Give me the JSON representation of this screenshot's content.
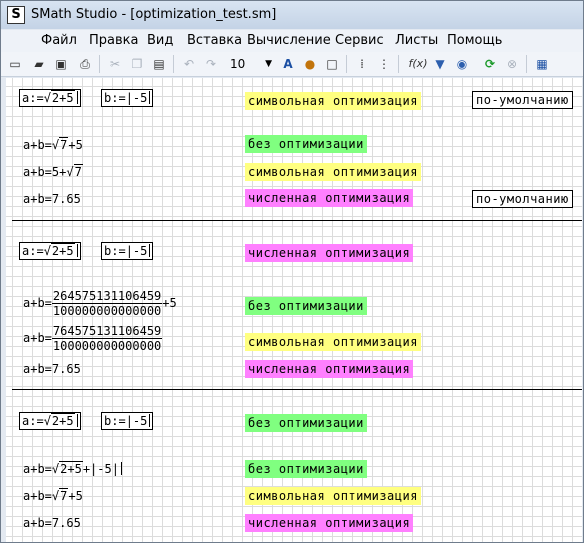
{
  "window": {
    "title": "SMath Studio - [optimization_test.sm]",
    "app_icon": "S"
  },
  "menu": [
    "Файл",
    "Правка",
    "Вид",
    "Вставка",
    "Вычисление",
    "Сервис",
    "Листы",
    "Помощь"
  ],
  "toolbar": {
    "font_size": "10",
    "fx": "f(x)"
  },
  "sections": [
    {
      "defs": {
        "a": "a:=√2+5",
        "b": "b:=-5"
      },
      "mode_label": "символьная оптимизация",
      "default_label": "по-умолчанию",
      "rows": [
        {
          "expr_prefix": "a+b=",
          "sqrt": "7",
          "expr_suffix": "+5",
          "label": "без оптимизации"
        },
        {
          "expr_prefix": "a+b=5+",
          "sqrt": "7",
          "expr_suffix": "",
          "label": "символьная оптимизация"
        },
        {
          "expr": "a+b=7.65",
          "label": "численная оптимизация",
          "default_label": "по-умолчанию"
        }
      ]
    },
    {
      "defs": {
        "a": "a:=√2+5",
        "b": "b:=-5"
      },
      "mode_label": "численная оптимизация",
      "rows": [
        {
          "expr_prefix": "a+b=",
          "num": "264575131106459",
          "den": "100000000000000",
          "expr_suffix": "+5",
          "label": "без оптимизации"
        },
        {
          "expr_prefix": "a+b=",
          "num": "764575131106459",
          "den": "100000000000000",
          "expr_suffix": "",
          "label": "символьная оптимизация"
        },
        {
          "expr": "a+b=7.65",
          "label": "численная оптимизация"
        }
      ]
    },
    {
      "defs": {
        "a": "a:=√2+5",
        "b": "b:=-5"
      },
      "mode_label": "без оптимизации",
      "rows": [
        {
          "expr_prefix": "a+b=",
          "sqrt": "2+5",
          "expr_suffix": "+|-5|",
          "label": "без оптимизации"
        },
        {
          "expr_prefix": "a+b=",
          "sqrt": "7",
          "expr_suffix": "+5",
          "label": "символьная оптимизация"
        },
        {
          "expr": "a+b=7.65",
          "label": "численная оптимизация"
        }
      ]
    }
  ],
  "colors": {
    "symbolic": "#ffff80",
    "none": "#80ff80",
    "numeric": "#ff80ff"
  }
}
